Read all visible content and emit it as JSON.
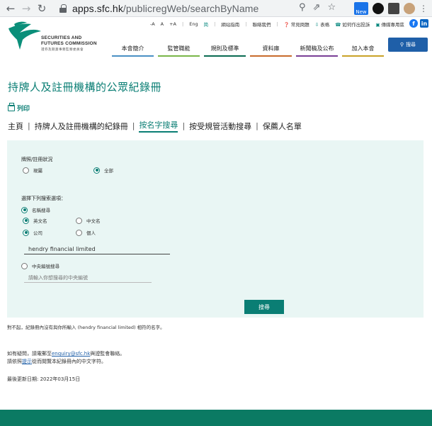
{
  "browser": {
    "url_host": "apps.sfc.hk",
    "url_path": "/publicregWeb/searchByName",
    "ext_new_label": "New"
  },
  "header": {
    "logo_line1": "SECURITIES AND",
    "logo_line2": "FUTURES COMMISSION",
    "logo_sub": "證券及期貨事務監察委員會",
    "util": {
      "font_small": "-A",
      "font_mid": "A",
      "font_large": "+A",
      "lang_en": "Eng",
      "lang_sc": "简",
      "sitemap": "網站指南",
      "contact": "聯絡我們",
      "faq": "常見問題",
      "forms": "表格",
      "complaint": "如何作出投訴",
      "media": "傳媒專用區"
    },
    "nav": [
      "本會簡介",
      "監管職能",
      "規則及標準",
      "資料庫",
      "新聞稿及公布",
      "加入本會"
    ],
    "search_label": "搜尋"
  },
  "content": {
    "title": "持牌人及註冊機構的公眾紀錄冊",
    "print_label": "列印",
    "breadcrumb": {
      "home": "主頁",
      "register": "持牌人及註冊機構的紀錄冊",
      "by_name": "按名字搜尋",
      "disciplinary": "按受規管活動搜尋",
      "sponsor": "保薦人名單"
    }
  },
  "form": {
    "status_label": "牌照/註冊狀況",
    "status_current": "現屬",
    "status_all": "全部",
    "choose_label": "選擇下列搜索選項：",
    "by_name": "名稱搜尋",
    "english_name": "英文名",
    "chinese_name": "中文名",
    "company": "公司",
    "individual": "個人",
    "name_value": "hendry financial limited",
    "by_ce": "中央編號搜尋",
    "ce_placeholder": "請輸入你想搜尋的中央編號",
    "submit_label": "搜尋"
  },
  "result": {
    "no_result": "對不起，紀錄冊內沒有與你所輸入 (hendry financial limited) 相符的名字。"
  },
  "help": {
    "line1_pre": "如有疑問，請電郵至",
    "email": "enquiry@sfc.hk",
    "line1_post": "與證監會聯絡。",
    "line2_pre": "請依照",
    "hint_link": "提示",
    "line2_post": "從而閱覽本紀錄冊內的中文字符。"
  },
  "updated": "最後更新日期: 2022年03月15日"
}
